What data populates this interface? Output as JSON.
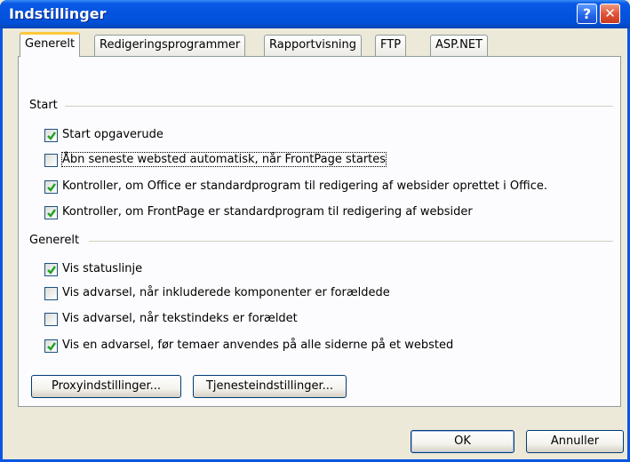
{
  "window": {
    "title": "Indstillinger"
  },
  "titlebar": {
    "help_glyph": "?",
    "close_glyph": "✕"
  },
  "tabs": [
    {
      "label": "Generelt",
      "active": true
    },
    {
      "label": "Redigeringsprogrammer",
      "active": false
    },
    {
      "label": "Rapportvisning",
      "active": false
    },
    {
      "label": "FTP",
      "active": false
    },
    {
      "label": "ASP.NET",
      "active": false
    }
  ],
  "groups": {
    "start": {
      "label": "Start",
      "items": [
        {
          "label": "Start opgaverude",
          "checked": true
        },
        {
          "label": "Åbn seneste websted automatisk, når FrontPage startes",
          "checked": false
        },
        {
          "label": "Kontroller, om Office er standardprogram til redigering af websider oprettet i Office.",
          "checked": true
        },
        {
          "label": "Kontroller, om FrontPage er standardprogram til redigering af websider",
          "checked": true
        }
      ]
    },
    "general": {
      "label": "Generelt",
      "items": [
        {
          "label": "Vis statuslinje",
          "checked": true
        },
        {
          "label": "Vis advarsel, når inkluderede komponenter er forældede",
          "checked": false
        },
        {
          "label": "Vis advarsel, når tekstindeks er forældet",
          "checked": false
        },
        {
          "label": "Vis en advarsel, før temaer anvendes på alle siderne på et websted",
          "checked": true
        }
      ]
    }
  },
  "buttons": {
    "proxy": "Proxyindstillinger...",
    "services": "Tjenesteindstillinger...",
    "ok": "OK",
    "cancel": "Annuller"
  },
  "colors": {
    "titlebar": "#0553E0",
    "tab_highlight": "#FFC83C",
    "checkmark": "#21A121",
    "face": "#ECE9D8"
  }
}
